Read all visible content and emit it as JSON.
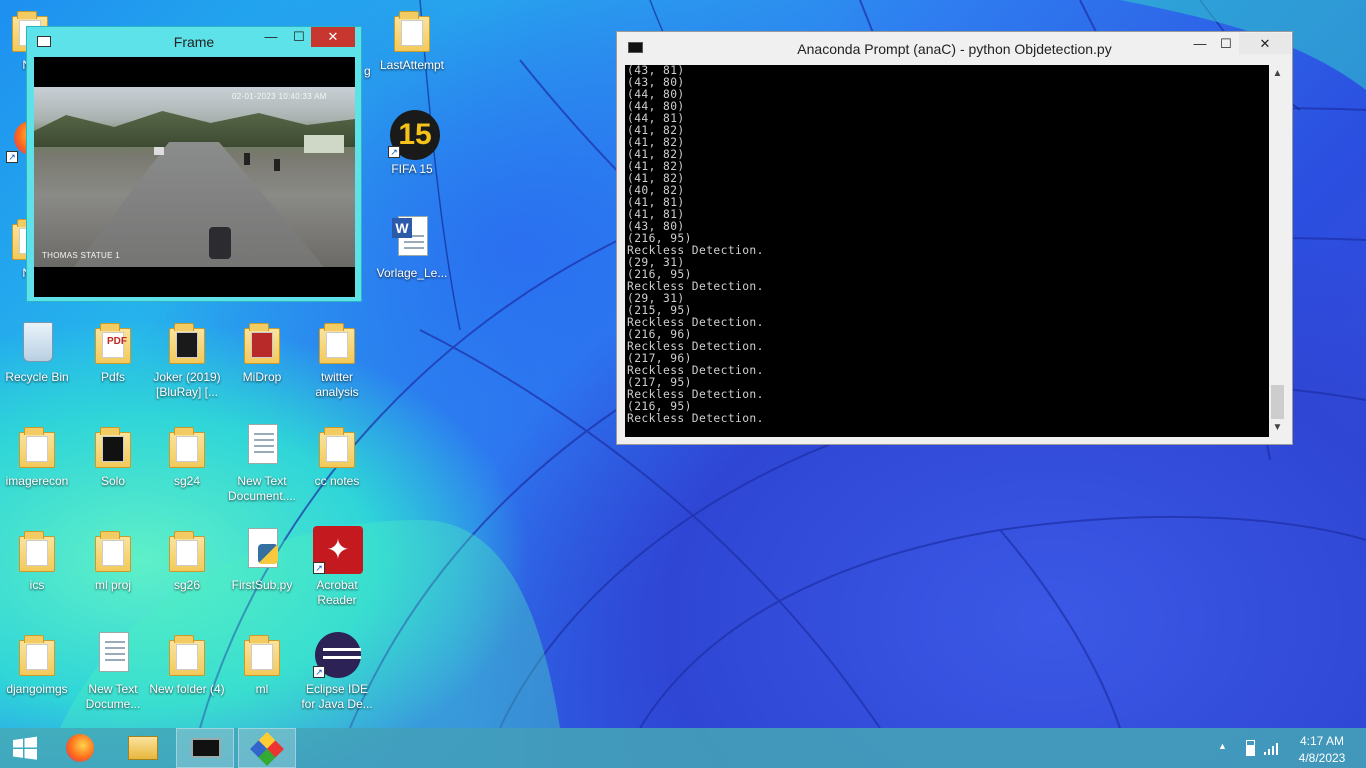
{
  "desktop": {
    "icons": [
      {
        "id": "new-1",
        "label": "Ne"
      },
      {
        "id": "f-1",
        "label": "F"
      },
      {
        "id": "new-2",
        "label": "Ne"
      },
      {
        "id": "last-attempt",
        "label": "LastAttempt"
      },
      {
        "id": "fifa15",
        "label": "FIFA 15"
      },
      {
        "id": "vorlage",
        "label": "Vorlage_Le..."
      },
      {
        "id": "recycle",
        "label": "Recycle Bin"
      },
      {
        "id": "pdfs",
        "label": "Pdfs"
      },
      {
        "id": "joker",
        "label": "Joker (2019) [BluRay] [..."
      },
      {
        "id": "midrop",
        "label": "MiDrop"
      },
      {
        "id": "twitter",
        "label": "twitter analysis"
      },
      {
        "id": "imagerecon",
        "label": "imagerecon"
      },
      {
        "id": "solo",
        "label": "Solo"
      },
      {
        "id": "sg24",
        "label": "sg24"
      },
      {
        "id": "newtext1",
        "label": "New Text Document...."
      },
      {
        "id": "ccnotes",
        "label": "cc notes"
      },
      {
        "id": "ics",
        "label": "ics"
      },
      {
        "id": "mlproj",
        "label": "ml proj"
      },
      {
        "id": "sg26",
        "label": "sg26"
      },
      {
        "id": "firstsub",
        "label": "FirstSub.py"
      },
      {
        "id": "acrobat",
        "label": "Acrobat Reader"
      },
      {
        "id": "djangoimgs",
        "label": "djangoimgs"
      },
      {
        "id": "newtext2",
        "label": "New Text Docume..."
      },
      {
        "id": "newfolder4",
        "label": "New folder (4)"
      },
      {
        "id": "ml",
        "label": "ml"
      },
      {
        "id": "eclipse",
        "label": "Eclipse IDE for Java De..."
      }
    ],
    "partial_label": "g"
  },
  "frame_window": {
    "title": "Frame",
    "minimize": "—",
    "maximize": "☐",
    "close": "✕",
    "overlay_timestamp": "02-01-2023 10:40:33 AM",
    "overlay_location": "THOMAS STATUE 1"
  },
  "cmd_window": {
    "title": "Anaconda Prompt (anaC) - python  Objdetection.py",
    "minimize": "—",
    "maximize": "☐",
    "close": "✕",
    "lines": [
      "(43, 81)",
      "(43, 80)",
      "(44, 80)",
      "(44, 80)",
      "(44, 81)",
      "(41, 82)",
      "(41, 82)",
      "(41, 82)",
      "(41, 82)",
      "(41, 82)",
      "(40, 82)",
      "(41, 81)",
      "(41, 81)",
      "(43, 80)",
      "(216, 95)",
      "Reckless Detection.",
      "(29, 31)",
      "(216, 95)",
      "Reckless Detection.",
      "(29, 31)",
      "(215, 95)",
      "Reckless Detection.",
      "(216, 96)",
      "Reckless Detection.",
      "(217, 96)",
      "Reckless Detection.",
      "(217, 95)",
      "Reckless Detection.",
      "(216, 95)",
      "Reckless Detection."
    ],
    "scroll_up": "▲",
    "scroll_down": "▼"
  },
  "taskbar": {
    "items": [
      "start-button",
      "firefox",
      "file-explorer",
      "command-prompt",
      "python-window"
    ],
    "tray": {
      "time": "4:17 AM",
      "date": "4/8/2023",
      "chevron": "▲"
    }
  }
}
